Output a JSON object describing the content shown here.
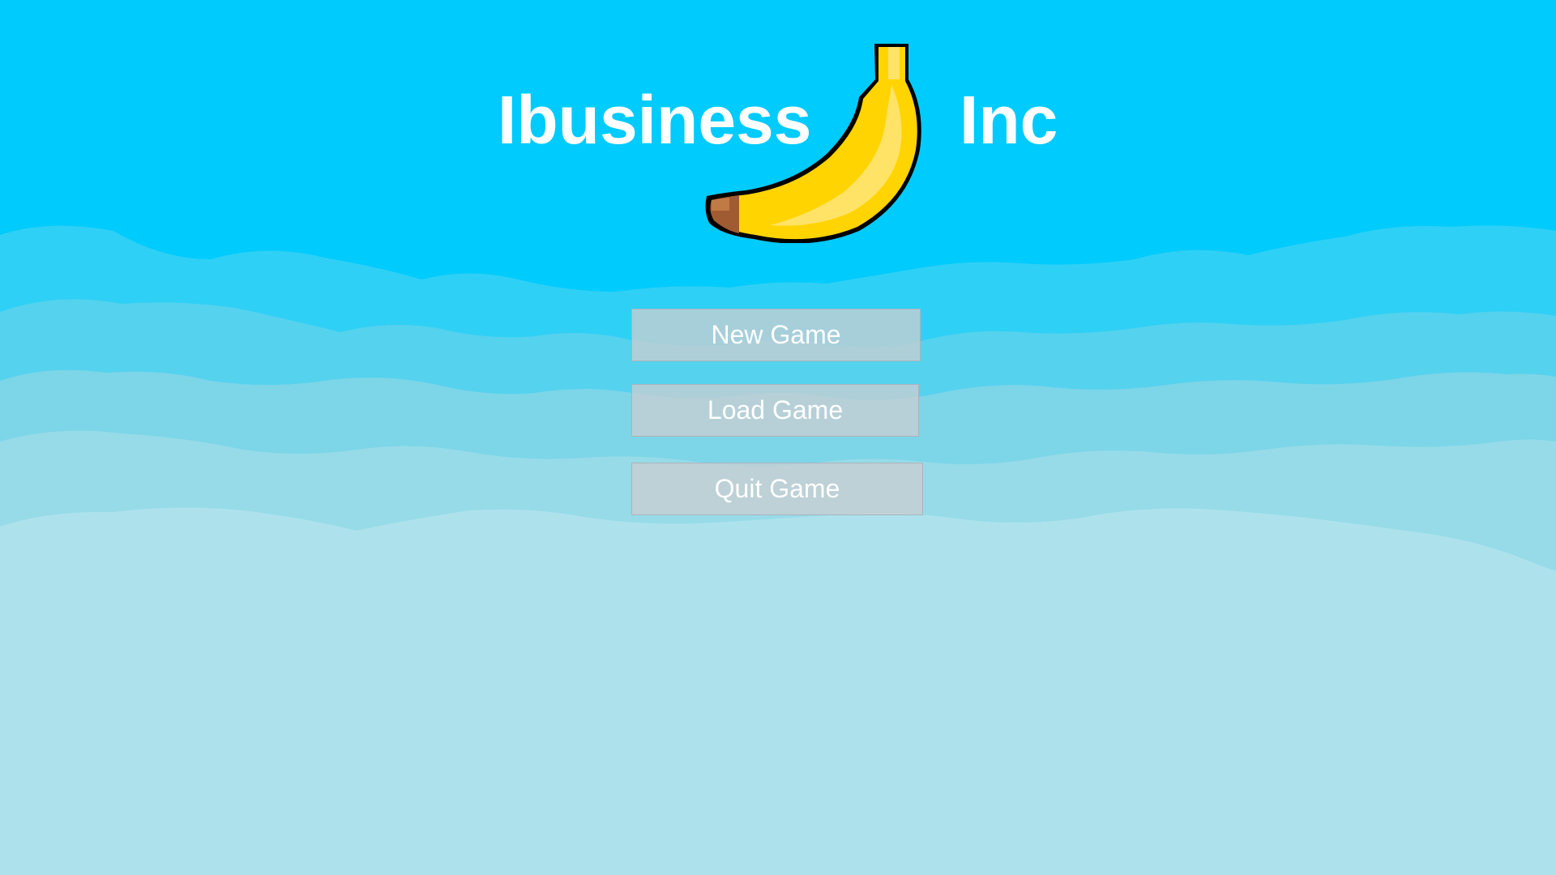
{
  "title": {
    "left_word": "Ibusiness",
    "right_word": "Inc"
  },
  "logo": {
    "icon": "banana-icon"
  },
  "menu": {
    "new_game_label": "New Game",
    "load_game_label": "Load Game",
    "quit_game_label": "Quit Game"
  },
  "colors": {
    "sky": "#00cbfd",
    "cloud_light": "#ade2ec",
    "banana_yellow": "#ffd400",
    "banana_tip": "#a15b32",
    "button_fill": "#c8ced2",
    "text": "#ffffff"
  }
}
